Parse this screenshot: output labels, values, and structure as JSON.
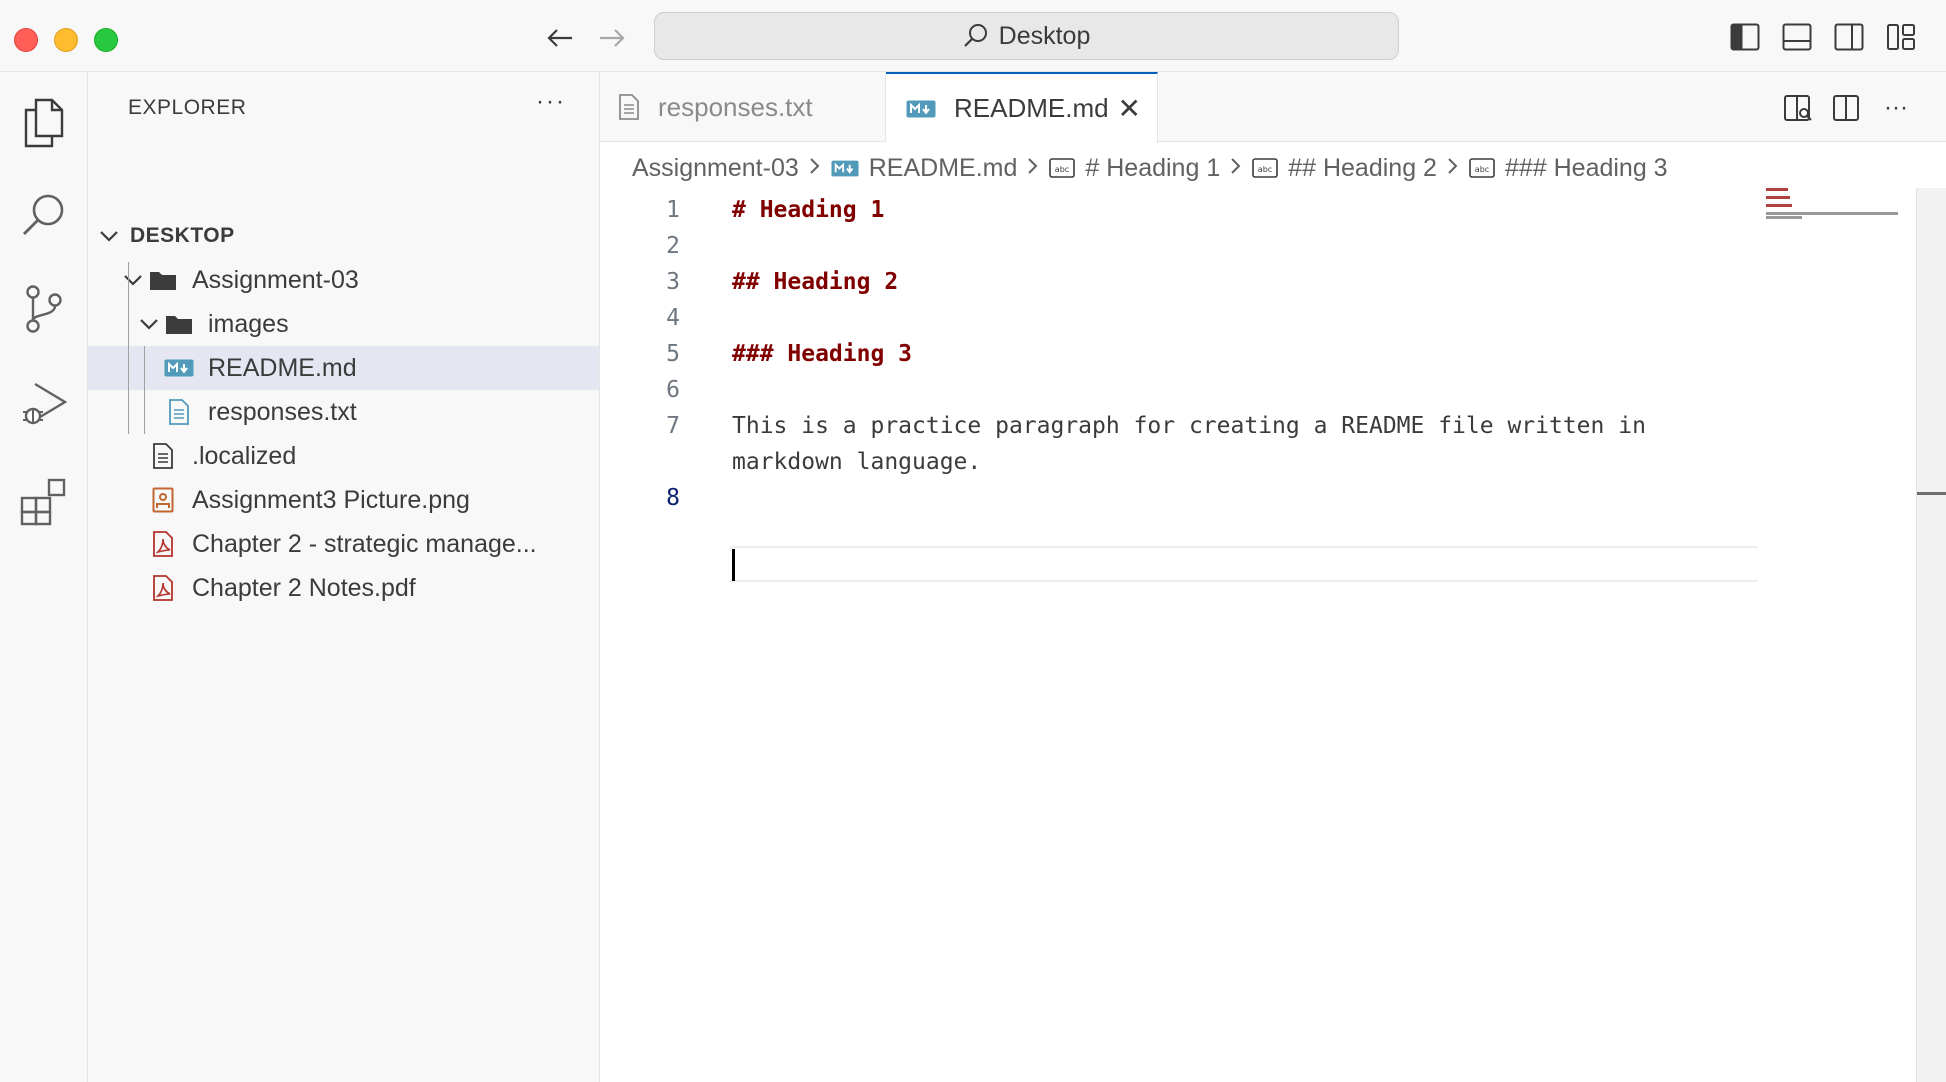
{
  "titlebar": {
    "search_label": "Desktop",
    "back_icon": "arrow-left-icon",
    "forward_icon": "arrow-right-icon"
  },
  "activity_bar": {
    "items": [
      {
        "name": "explorer",
        "icon": "files-icon"
      },
      {
        "name": "search",
        "icon": "search-icon"
      },
      {
        "name": "source-control",
        "icon": "source-control-icon"
      },
      {
        "name": "run-debug",
        "icon": "run-debug-icon"
      },
      {
        "name": "extensions",
        "icon": "extensions-icon"
      }
    ]
  },
  "sidebar": {
    "title": "EXPLORER",
    "more": "···",
    "workspace": "DESKTOP",
    "tree": [
      {
        "label": "Assignment-03",
        "type": "folder",
        "expanded": true
      },
      {
        "label": "images",
        "type": "folder",
        "expanded": true
      },
      {
        "label": "README.md",
        "type": "markdown",
        "selected": true
      },
      {
        "label": "responses.txt",
        "type": "text"
      },
      {
        "label": ".localized",
        "type": "text"
      },
      {
        "label": "Assignment3 Picture.png",
        "type": "image"
      },
      {
        "label": "Chapter 2 - strategic manage...",
        "type": "pdf"
      },
      {
        "label": "Chapter 2 Notes.pdf",
        "type": "pdf"
      }
    ]
  },
  "editor": {
    "tabs": [
      {
        "label": "responses.txt",
        "active": false
      },
      {
        "label": "README.md",
        "active": true
      }
    ],
    "close_glyph": "✕",
    "more": "···",
    "breadcrumbs": [
      "Assignment-03",
      "README.md",
      "# Heading 1",
      "## Heading 2",
      "### Heading 3"
    ],
    "lines": [
      {
        "n": "1",
        "text": "# Heading 1",
        "kind": "heading"
      },
      {
        "n": "2",
        "text": "",
        "kind": "plain"
      },
      {
        "n": "3",
        "text": "## Heading 2",
        "kind": "heading"
      },
      {
        "n": "4",
        "text": "",
        "kind": "plain"
      },
      {
        "n": "5",
        "text": "### Heading 3",
        "kind": "heading"
      },
      {
        "n": "6",
        "text": "",
        "kind": "plain"
      },
      {
        "n": "7",
        "text": "This is a practice paragraph for creating a README file written in",
        "kind": "plain"
      },
      {
        "n": "",
        "text": "markdown language.",
        "kind": "plain"
      },
      {
        "n": "8",
        "text": "",
        "kind": "plain",
        "active": true
      }
    ]
  },
  "colors": {
    "heading": "#800000",
    "accent": "#005fb8",
    "selection": "#e4e6f1",
    "markdown_icon": "#519aba",
    "pdf_icon": "#b5322d",
    "image_icon": "#c0662f"
  }
}
